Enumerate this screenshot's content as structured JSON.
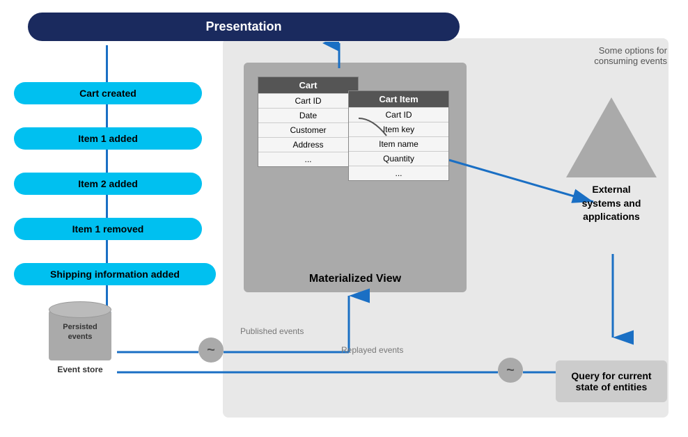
{
  "presentation": {
    "label": "Presentation"
  },
  "events": {
    "cart_created": "Cart created",
    "item1_added": "Item 1 added",
    "item2_added": "Item 2 added",
    "item1_removed": "Item 1 removed",
    "shipping_added": "Shipping information added"
  },
  "cart_table": {
    "header": "Cart",
    "rows": [
      "Cart ID",
      "Date",
      "Customer",
      "Address",
      "..."
    ]
  },
  "cart_item_table": {
    "header": "Cart Item",
    "rows": [
      "Cart ID",
      "Item key",
      "Item name",
      "Quantity",
      "..."
    ]
  },
  "materialized_view": {
    "label": "Materialized View"
  },
  "event_store": {
    "cylinder_label": "Persisted\nevents",
    "label": "Event store"
  },
  "external_systems": {
    "label": "External\nsystems and\napplications"
  },
  "query_box": {
    "label": "Query for\ncurrent state\nof entities"
  },
  "labels": {
    "some_options": "Some options for\nconsuming events",
    "published_events": "Published events",
    "replayed_events": "Replayed events"
  },
  "wave": {
    "symbol": "~"
  }
}
